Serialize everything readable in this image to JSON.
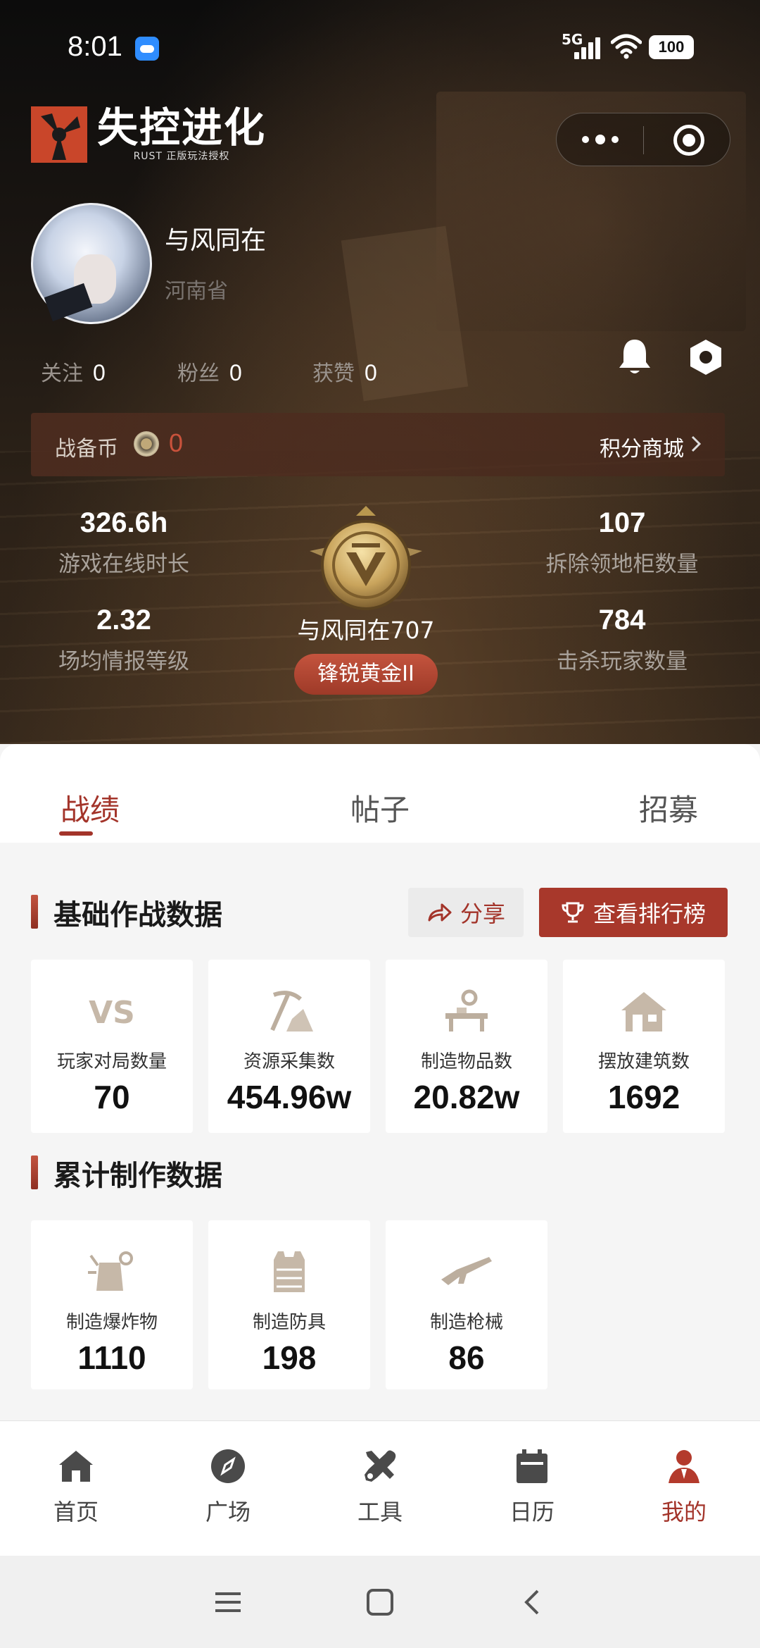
{
  "status": {
    "time": "8:01",
    "signal": "5G",
    "battery": "100"
  },
  "brand": {
    "name": "失控进化",
    "sub": "RUST 正版玩法授权"
  },
  "profile": {
    "name": "与风同在",
    "location": "河南省"
  },
  "social": [
    {
      "label": "关注",
      "value": "0"
    },
    {
      "label": "粉丝",
      "value": "0"
    },
    {
      "label": "获赞",
      "value": "0"
    }
  ],
  "coins": {
    "label": "战备币",
    "value": "0",
    "mall": "积分商城"
  },
  "stats": {
    "online_time": {
      "value": "326.6h",
      "label": "游戏在线时长"
    },
    "intel_level": {
      "value": "2.32",
      "label": "场均情报等级"
    },
    "cabinets": {
      "value": "107",
      "label": "拆除领地柜数量"
    },
    "kills": {
      "value": "784",
      "label": "击杀玩家数量"
    }
  },
  "rank": {
    "player": "与风同在707",
    "tier": "锋锐黄金II"
  },
  "tabs": [
    "战绩",
    "帖子",
    "招募"
  ],
  "basic": {
    "title": "基础作战数据",
    "share": "分享",
    "ranking": "查看排行榜",
    "cards": [
      {
        "icon": "vs-icon",
        "label": "玩家对局数量",
        "value": "70"
      },
      {
        "icon": "pickaxe-icon",
        "label": "资源采集数",
        "value": "454.96w"
      },
      {
        "icon": "workbench-icon",
        "label": "制造物品数",
        "value": "20.82w"
      },
      {
        "icon": "house-icon",
        "label": "摆放建筑数",
        "value": "1692"
      }
    ]
  },
  "crafting": {
    "title": "累计制作数据",
    "cards": [
      {
        "icon": "explosive-icon",
        "label": "制造爆炸物",
        "value": "1110"
      },
      {
        "icon": "armor-icon",
        "label": "制造防具",
        "value": "198"
      },
      {
        "icon": "rifle-icon",
        "label": "制造枪械",
        "value": "86"
      }
    ]
  },
  "tabbar": [
    {
      "icon": "home-icon",
      "label": "首页"
    },
    {
      "icon": "compass-icon",
      "label": "广场"
    },
    {
      "icon": "tools-icon",
      "label": "工具"
    },
    {
      "icon": "calendar-icon",
      "label": "日历"
    },
    {
      "icon": "profile-icon",
      "label": "我的",
      "active": true
    }
  ],
  "colors": {
    "accent": "#a3342a",
    "coin_value": "#c9523b",
    "badge_gold": "#c9a45c"
  }
}
